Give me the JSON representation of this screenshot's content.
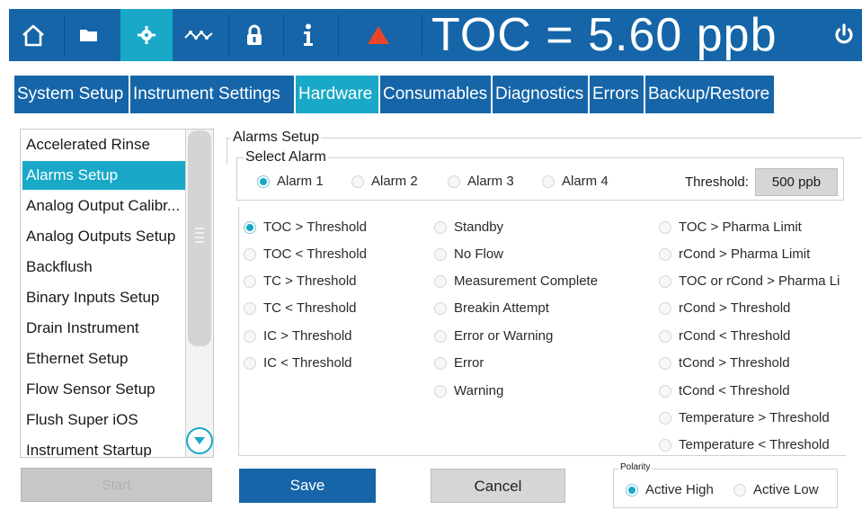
{
  "topbar": {
    "readout": "TOC = 5.60 ppb",
    "buttons": [
      {
        "icon": "home-icon"
      },
      {
        "icon": "folder-icon"
      },
      {
        "icon": "gear-icon",
        "active": true
      },
      {
        "icon": "trend-icon"
      },
      {
        "icon": "lock-icon"
      },
      {
        "icon": "info-icon"
      },
      {
        "icon": "warning-icon"
      }
    ],
    "power_icon": "power-icon",
    "colors": {
      "bar": "#1565a8",
      "active": "#19a8c7",
      "warning": "#e8452c"
    }
  },
  "tabs": [
    {
      "label": "System Setup",
      "active": false
    },
    {
      "label": "Instrument Settings",
      "active": false
    },
    {
      "label": "Hardware",
      "active": true
    },
    {
      "label": "Consumables",
      "active": false
    },
    {
      "label": "Diagnostics",
      "active": false
    },
    {
      "label": "Errors",
      "active": false
    },
    {
      "label": "Backup/Restore",
      "active": false
    }
  ],
  "sidebar": {
    "items": [
      "Accelerated Rinse",
      "Alarms Setup",
      "Analog Output Calibr...",
      "Analog Outputs Setup",
      "Backflush",
      "Binary Inputs Setup",
      "Drain Instrument",
      "Ethernet Setup",
      "Flow Sensor Setup",
      "Flush Super iOS",
      "Instrument Startup"
    ],
    "selected": "Alarms Setup",
    "bottom_button": "Start"
  },
  "alarms_setup": {
    "title": "Alarms Setup",
    "select_alarm": {
      "title": "Select Alarm",
      "options": [
        "Alarm 1",
        "Alarm 2",
        "Alarm 3",
        "Alarm 4"
      ],
      "selected": "Alarm 1"
    },
    "threshold": {
      "label": "Threshold:",
      "value": "500 ppb"
    },
    "conditions": {
      "col1": [
        "TOC > Threshold",
        "TOC < Threshold",
        "TC > Threshold",
        "TC < Threshold",
        "IC > Threshold",
        "IC < Threshold"
      ],
      "col2": [
        "Standby",
        "No Flow",
        "Measurement Complete",
        "Breakin Attempt",
        "Error or Warning",
        "Error",
        "Warning"
      ],
      "col3": [
        "TOC > Pharma Limit",
        "rCond > Pharma Limit",
        "TOC or rCond > Pharma Li",
        "rCond > Threshold",
        "rCond < Threshold",
        "tCond > Threshold",
        "tCond < Threshold",
        "Temperature > Threshold",
        "Temperature < Threshold"
      ],
      "selected": "TOC > Threshold"
    },
    "save_label": "Save",
    "cancel_label": "Cancel",
    "polarity": {
      "title": "Polarity",
      "options": [
        "Active High",
        "Active Low"
      ],
      "selected": "Active High"
    }
  }
}
